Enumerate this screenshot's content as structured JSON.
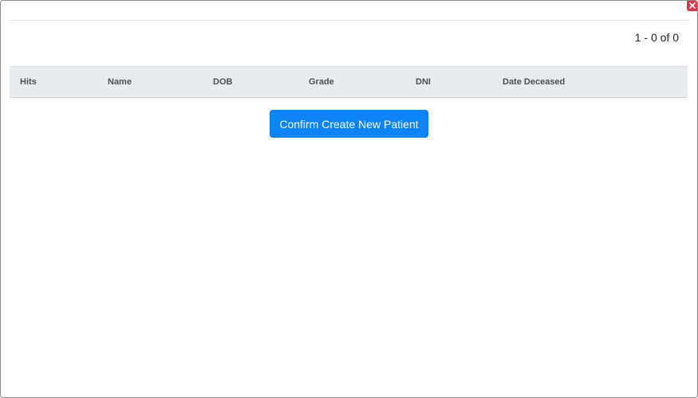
{
  "modal": {
    "close_icon": "close-icon",
    "close_color": "#dc3545"
  },
  "pagination": {
    "text": "1 - 0 of 0"
  },
  "table": {
    "columns": [
      "Hits",
      "Name",
      "DOB",
      "Grade",
      "DNI",
      "Date Deceased"
    ],
    "rows": []
  },
  "actions": {
    "confirm_label": "Confirm Create New Patient",
    "confirm_color": "#0d84f7"
  }
}
